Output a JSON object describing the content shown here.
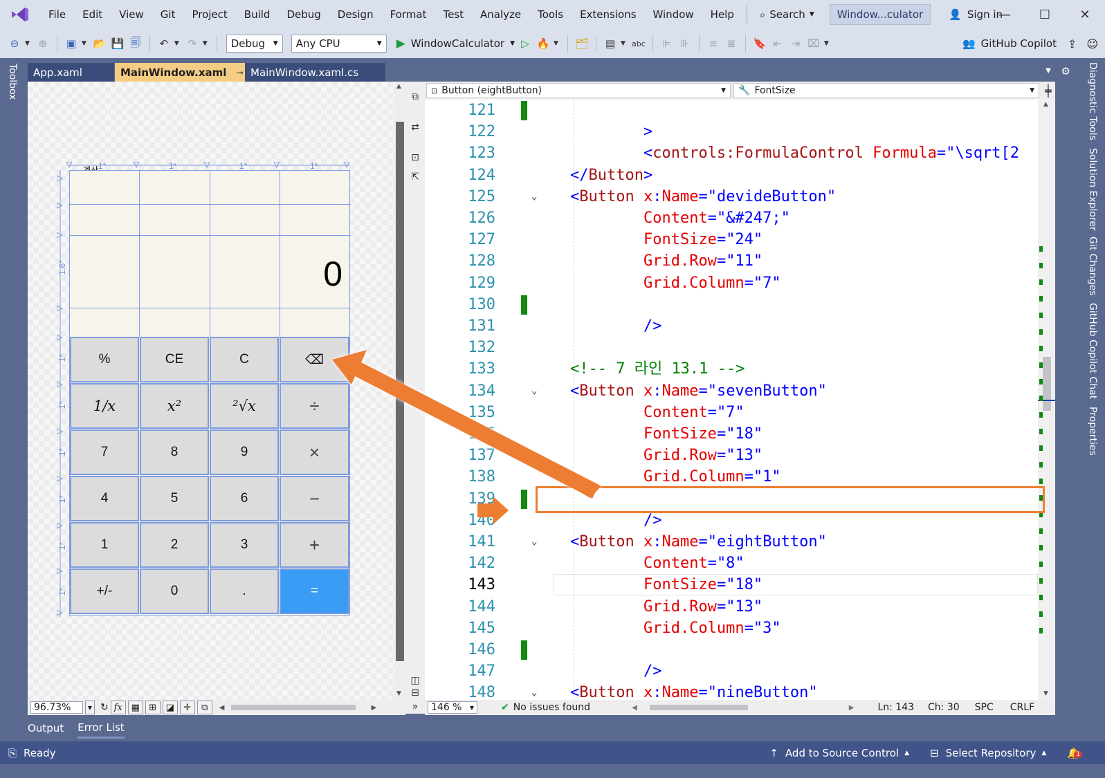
{
  "menu": {
    "items": [
      "File",
      "Edit",
      "View",
      "Git",
      "Project",
      "Build",
      "Debug",
      "Design",
      "Format",
      "Test",
      "Analyze",
      "Tools",
      "Extensions",
      "Window",
      "Help"
    ],
    "search_label": "Search",
    "window_title": "Window...culator",
    "sign_in": "Sign in"
  },
  "toolbar": {
    "config": "Debug",
    "platform": "Any CPU",
    "start_target": "WindowCalculator",
    "copilot": "GitHub Copilot"
  },
  "side_tabs": {
    "left": "Toolbox",
    "right": [
      "Diagnostic Tools",
      "Solution Explorer",
      "Git Changes",
      "GitHub Copilot Chat",
      "Properties"
    ]
  },
  "tabs": [
    {
      "label": "App.xaml"
    },
    {
      "label": "MainWindow.xaml"
    },
    {
      "label": "MainWindow.xaml.cs"
    }
  ],
  "designer": {
    "zoom": "96.73%",
    "window_caption": "계산",
    "column_ruler": [
      "1*",
      "1*",
      "1*",
      "1*"
    ],
    "row_ruler": [
      "1.6*",
      "1*",
      "1*",
      "1*",
      "1*",
      "1*",
      "1*"
    ],
    "display": "0",
    "keys": [
      [
        "%",
        "CE",
        "C",
        "⌫"
      ],
      [
        "1/x",
        "x²",
        "²√x",
        "÷"
      ],
      [
        "7",
        "8",
        "9",
        "×"
      ],
      [
        "4",
        "5",
        "6",
        "−"
      ],
      [
        "1",
        "2",
        "3",
        "+"
      ],
      [
        "+/-",
        "0",
        ".",
        "="
      ]
    ]
  },
  "editor": {
    "element_combo": "Button (eightButton)",
    "property_combo": "FontSize",
    "lines": [
      {
        "n": "121",
        "html": ""
      },
      {
        "n": "122",
        "html": "        <span class=\"punc\">&gt;</span>"
      },
      {
        "n": "123",
        "html": "        <span class=\"punc\">&lt;</span><span class=\"tag\">controls:FormulaControl</span> <span class=\"attr\">Formula</span><span class=\"punc\">=</span><span class=\"str\">\"\\sqrt[2</span>"
      },
      {
        "n": "124",
        "html": "<span class=\"punc\">&lt;/</span><span class=\"tag\">Button</span><span class=\"punc\">&gt;</span>"
      },
      {
        "n": "125",
        "html": "<span class=\"punc\">&lt;</span><span class=\"tag\">Button</span> <span class=\"attr\">x</span><span class=\"punc\">:</span><span class=\"attr\">Name</span><span class=\"punc\">=</span><span class=\"str\">\"devideButton\"</span>"
      },
      {
        "n": "126",
        "html": "        <span class=\"attr\">Content</span><span class=\"punc\">=</span><span class=\"str\">\"&amp;#247;\"</span>"
      },
      {
        "n": "127",
        "html": "        <span class=\"attr\">FontSize</span><span class=\"punc\">=</span><span class=\"str\">\"24\"</span>"
      },
      {
        "n": "128",
        "html": "        <span class=\"attr\">Grid.Row</span><span class=\"punc\">=</span><span class=\"str\">\"11\"</span>"
      },
      {
        "n": "129",
        "html": "        <span class=\"attr\">Grid.Column</span><span class=\"punc\">=</span><span class=\"str\">\"7\"</span>"
      },
      {
        "n": "130",
        "html": ""
      },
      {
        "n": "131",
        "html": "        <span class=\"punc\">/&gt;</span>"
      },
      {
        "n": "132",
        "html": ""
      },
      {
        "n": "133",
        "html": "<span class=\"cmt\">&lt;!-- 7 라인 13.1 --&gt;</span>"
      },
      {
        "n": "134",
        "html": "<span class=\"punc\">&lt;</span><span class=\"tag\">Button</span> <span class=\"attr\">x</span><span class=\"punc\">:</span><span class=\"attr\">Name</span><span class=\"punc\">=</span><span class=\"str\">\"sevenButton\"</span>"
      },
      {
        "n": "135",
        "html": "        <span class=\"attr\">Content</span><span class=\"punc\">=</span><span class=\"str\">\"7\"</span>"
      },
      {
        "n": "136",
        "html": "        <span class=\"attr\">FontSize</span><span class=\"punc\">=</span><span class=\"str\">\"18\"</span>"
      },
      {
        "n": "137",
        "html": "        <span class=\"attr\">Grid.Row</span><span class=\"punc\">=</span><span class=\"str\">\"13\"</span>"
      },
      {
        "n": "138",
        "html": "        <span class=\"attr\">Grid.Column</span><span class=\"punc\">=</span><span class=\"str\">\"1\"</span>"
      },
      {
        "n": "139",
        "html": ""
      },
      {
        "n": "140",
        "html": "        <span class=\"punc\">/&gt;</span>"
      },
      {
        "n": "141",
        "html": "<span class=\"punc\">&lt;</span><span class=\"tag\">Button</span> <span class=\"attr\">x</span><span class=\"punc\">:</span><span class=\"attr\">Name</span><span class=\"punc\">=</span><span class=\"str\">\"eightButton\"</span>"
      },
      {
        "n": "142",
        "html": "        <span class=\"attr\">Content</span><span class=\"punc\">=</span><span class=\"str\">\"8\"</span>"
      },
      {
        "n": "143",
        "html": "        <span class=\"attr\">FontSize</span><span class=\"punc\">=</span><span class=\"str\">\"18\"</span>"
      },
      {
        "n": "144",
        "html": "        <span class=\"attr\">Grid.Row</span><span class=\"punc\">=</span><span class=\"str\">\"13\"</span>"
      },
      {
        "n": "145",
        "html": "        <span class=\"attr\">Grid.Column</span><span class=\"punc\">=</span><span class=\"str\">\"3\"</span>"
      },
      {
        "n": "146",
        "html": ""
      },
      {
        "n": "147",
        "html": "        <span class=\"punc\">/&gt;</span>"
      },
      {
        "n": "148",
        "html": "<span class=\"punc\">&lt;</span><span class=\"tag\">Button</span> <span class=\"attr\">x</span><span class=\"punc\">:</span><span class=\"attr\">Name</span><span class=\"punc\">=</span><span class=\"str\">\"nineButton\"</span>"
      }
    ],
    "current_line": "143",
    "zoom": "146 %",
    "issues": "No issues found",
    "position": "Ln: 143",
    "column": "Ch: 30",
    "indent": "SPC",
    "eol": "CRLF"
  },
  "tool_windows": [
    "Output",
    "Error List"
  ],
  "status": {
    "ready": "Ready",
    "source_control": "Add to Source Control",
    "repository": "Select Repository",
    "notifications": "1"
  },
  "colors": {
    "accent": "#59698f",
    "annotation": "#ed7d31",
    "equals_button": "#3a9cf4"
  }
}
